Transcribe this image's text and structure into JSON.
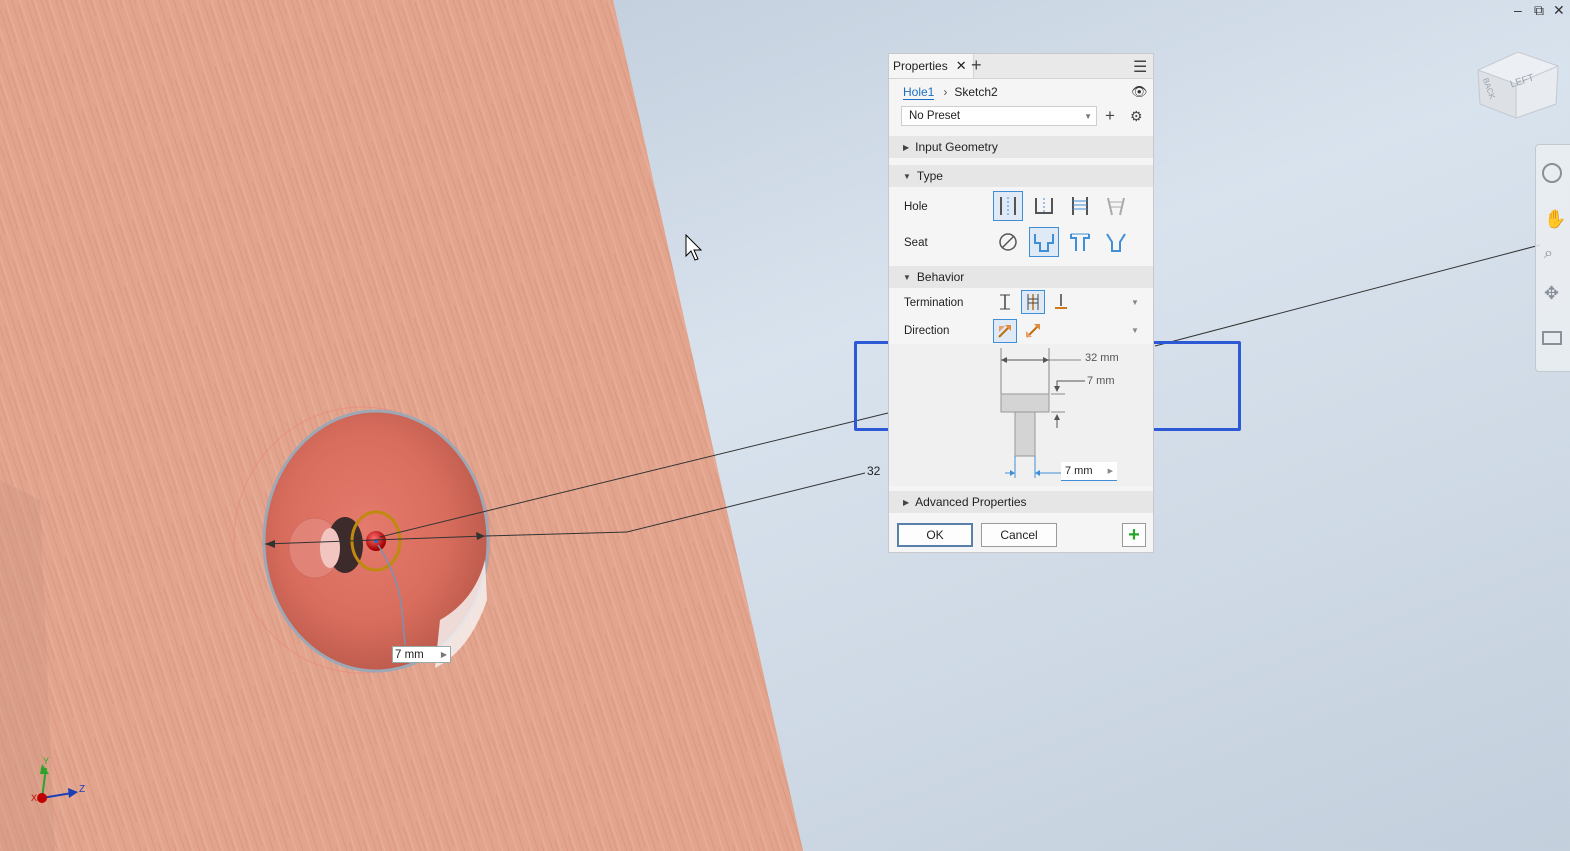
{
  "colors": {
    "accent": "#2d58d6",
    "link": "#1a6fc2",
    "selected_icon_bg": "#dfeaf6",
    "ok_green": "#2aa52a",
    "wood": "#e0a089"
  },
  "viewcube": {
    "face_left": "LEFT",
    "face_back": "BACK"
  },
  "panel": {
    "tab_label": "Properties",
    "breadcrumb": {
      "feature": "Hole1",
      "sketch": "Sketch2"
    },
    "preset": {
      "value": "No Preset"
    },
    "sections": {
      "input_geometry": "Input Geometry",
      "type": "Type",
      "behavior": "Behavior",
      "advanced": "Advanced Properties"
    },
    "labels": {
      "hole": "Hole",
      "seat": "Seat",
      "termination": "Termination",
      "direction": "Direction"
    },
    "diagram": {
      "top_dim": "32 mm",
      "depth_dim": "7 mm",
      "dia_input": "7 mm"
    },
    "buttons": {
      "ok": "OK",
      "cancel": "Cancel"
    }
  },
  "viewport": {
    "dim_on_part": "7 mm",
    "dim_32_label": "32",
    "axes": {
      "x": "X",
      "y": "Y",
      "z": "Z"
    }
  }
}
